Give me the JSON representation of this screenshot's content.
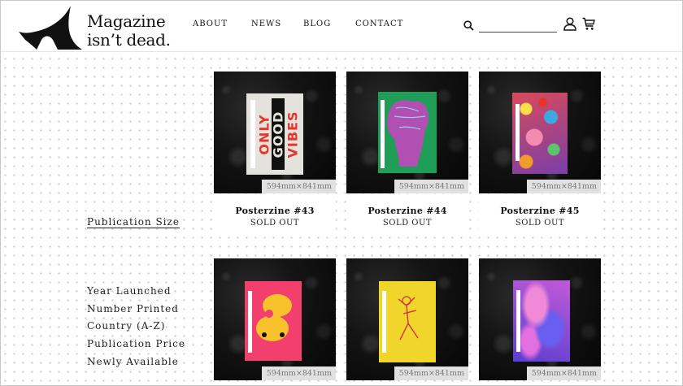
{
  "brand": {
    "line1": "Magazine",
    "line2": "isn’t dead."
  },
  "nav": [
    "ABOUT",
    "NEWS",
    "BLOG",
    "CONTACT"
  ],
  "search": {
    "value": "",
    "placeholder": ""
  },
  "icons": {
    "search": "search-icon",
    "account": "user-icon",
    "cart": "cart-icon"
  },
  "sidebar": {
    "size_link": "Publication Size",
    "sort": [
      "Year Launched",
      "Number Printed",
      "Country (A-Z)",
      "Publication Price",
      "Newly Available"
    ]
  },
  "products": [
    {
      "title": "Posterzine #43",
      "status": "SOLD OUT",
      "size": "594mm×841mm",
      "poster_text": [
        "ONLY",
        "GOOD",
        "VIBES"
      ]
    },
    {
      "title": "Posterzine #44",
      "status": "SOLD OUT",
      "size": "594mm×841mm"
    },
    {
      "title": "Posterzine #45",
      "status": "SOLD OUT",
      "size": "594mm×841mm"
    },
    {
      "size": "594mm×841mm"
    },
    {
      "size": "594mm×841mm"
    },
    {
      "size": "594mm×841mm"
    }
  ],
  "colors": {
    "poster43": "#e4e2dc",
    "poster44": "#1f9e57",
    "poster45": "#d84a5b",
    "poster46": "#f23f6d",
    "poster47": "#f0d52a",
    "poster48": "#b044c8",
    "accent_red": "#e8352b"
  }
}
